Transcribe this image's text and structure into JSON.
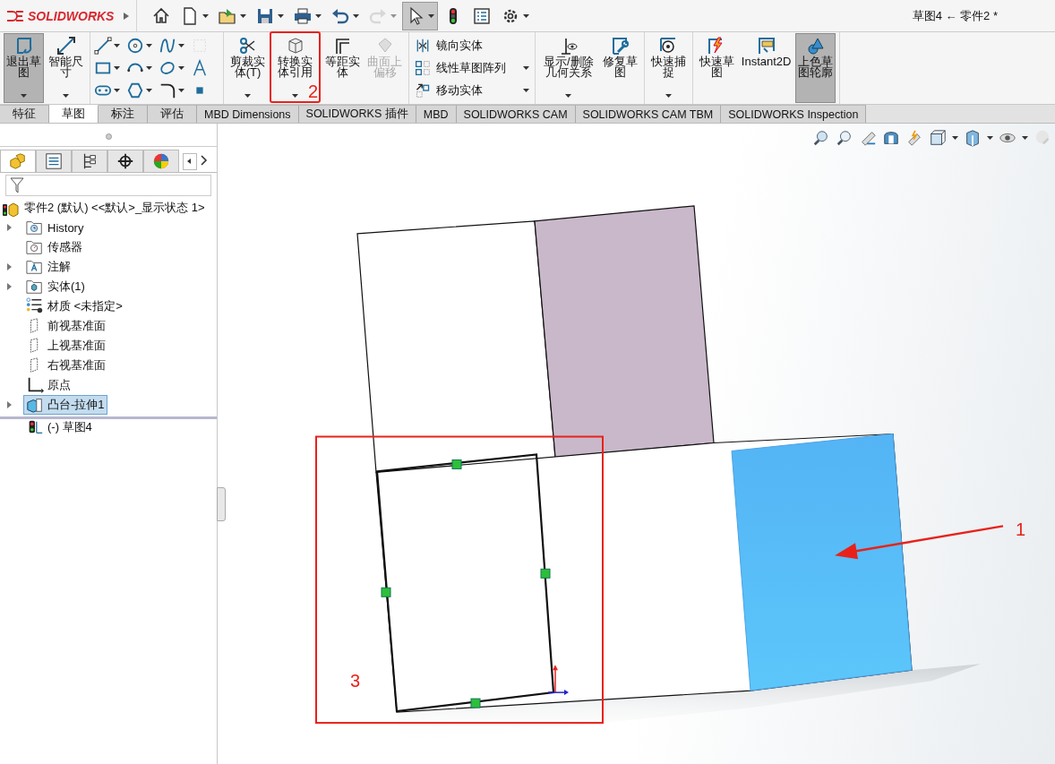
{
  "title_bar": {
    "logo": "SOLIDWORKS",
    "document_title": "草图4 ← 零件2 *"
  },
  "quick_tools": [
    {
      "selected": false,
      "dropdown": false
    },
    {
      "selected": false,
      "dropdown": true
    },
    {
      "selected": false,
      "dropdown": true
    },
    {
      "selected": false,
      "dropdown": true
    },
    {
      "selected": false,
      "dropdown": true
    },
    {
      "selected": false,
      "dropdown": true
    },
    {
      "selected": false,
      "dropdown": true,
      "disabled": true
    },
    {
      "selected": true,
      "dropdown": true
    },
    {
      "selected": false,
      "dropdown": false
    },
    {
      "selected": false,
      "dropdown": false
    },
    {
      "selected": false,
      "dropdown": true
    }
  ],
  "ribbon": {
    "groups": [
      {
        "kind": "large",
        "items": [
          {
            "label": "退出草图",
            "selected": true,
            "dropdown": true,
            "disabled": false
          },
          {
            "label": "智能尺寸",
            "selected": false,
            "dropdown": true,
            "disabled": false
          }
        ]
      },
      {
        "kind": "grid",
        "items": [
          {
            "dropdown": true,
            "disabled": false
          },
          {
            "dropdown": true,
            "disabled": false
          },
          {
            "dropdown": true,
            "disabled": false
          },
          {
            "dropdown": false,
            "disabled": true
          },
          {
            "dropdown": true,
            "disabled": false
          },
          {
            "dropdown": true,
            "disabled": false
          },
          {
            "dropdown": true,
            "disabled": false
          },
          {
            "dropdown": false,
            "disabled": false
          },
          {
            "dropdown": true,
            "disabled": false
          },
          {
            "dropdown": true,
            "disabled": false
          },
          {
            "dropdown": true,
            "disabled": false
          },
          {
            "dropdown": false,
            "disabled": false
          }
        ]
      },
      {
        "kind": "large",
        "items": [
          {
            "label": "剪裁实体(T)",
            "selected": false,
            "dropdown": true,
            "disabled": false
          },
          {
            "label": "转换实体引用",
            "selected": false,
            "dropdown": true,
            "disabled": false
          },
          {
            "label": "等距实体",
            "selected": false,
            "dropdown": false,
            "disabled": false
          },
          {
            "label": "曲面上偏移",
            "selected": false,
            "dropdown": false,
            "disabled": true
          }
        ]
      },
      {
        "kind": "list",
        "items": [
          {
            "label": "镜向实体",
            "dropdown": false
          },
          {
            "label": "线性草图阵列",
            "dropdown": true
          },
          {
            "label": "移动实体",
            "dropdown": true
          }
        ]
      },
      {
        "kind": "large",
        "items": [
          {
            "label": "显示/删除几何关系",
            "selected": false,
            "dropdown": true,
            "disabled": false
          },
          {
            "label": "修复草图",
            "selected": false,
            "dropdown": false,
            "disabled": false
          }
        ]
      },
      {
        "kind": "large",
        "items": [
          {
            "label": "快速捕捉",
            "selected": false,
            "dropdown": true,
            "disabled": false
          }
        ]
      },
      {
        "kind": "large",
        "items": [
          {
            "label": "快速草图",
            "selected": false,
            "dropdown": false,
            "disabled": false
          },
          {
            "label": "Instant2D",
            "selected": false,
            "dropdown": false,
            "disabled": false
          },
          {
            "label": "上色草图轮廓",
            "selected": true,
            "dropdown": false,
            "disabled": false
          }
        ]
      }
    ]
  },
  "tabs": [
    {
      "label": "特征",
      "selected": false
    },
    {
      "label": "草图",
      "selected": true
    },
    {
      "label": "标注",
      "selected": false
    },
    {
      "label": "评估",
      "selected": false
    },
    {
      "label": "MBD Dimensions",
      "selected": false
    },
    {
      "label": "SOLIDWORKS 插件",
      "selected": false
    },
    {
      "label": "MBD",
      "selected": false
    },
    {
      "label": "SOLIDWORKS CAM",
      "selected": false
    },
    {
      "label": "SOLIDWORKS CAM TBM",
      "selected": false
    },
    {
      "label": "SOLIDWORKS Inspection",
      "selected": false
    }
  ],
  "panel_tabs": [
    {
      "selected": true
    },
    {
      "selected": false
    },
    {
      "selected": false
    },
    {
      "selected": false
    },
    {
      "selected": false
    }
  ],
  "tree": {
    "label": "零件2 (默认) <<默认>_显示状态 1>",
    "children": [
      {
        "label": "History",
        "expanded": false,
        "selected": false
      },
      {
        "label": "传感器",
        "selected": false
      },
      {
        "label": "注解",
        "expanded": false,
        "selected": false
      },
      {
        "label": "实体(1)",
        "expanded": false,
        "selected": false
      },
      {
        "label": "材质 <未指定>",
        "selected": false
      },
      {
        "label": "前视基准面",
        "selected": false
      },
      {
        "label": "上视基准面",
        "selected": false
      },
      {
        "label": "右视基准面",
        "selected": false
      },
      {
        "label": "原点",
        "selected": false
      },
      {
        "label": "凸台-拉伸1",
        "expanded": false,
        "selected": true
      },
      {
        "label": "(-) 草图4",
        "selected": false
      }
    ]
  },
  "annotations": [
    {
      "label": "2"
    },
    {
      "label": "1"
    },
    {
      "label": "3"
    }
  ]
}
